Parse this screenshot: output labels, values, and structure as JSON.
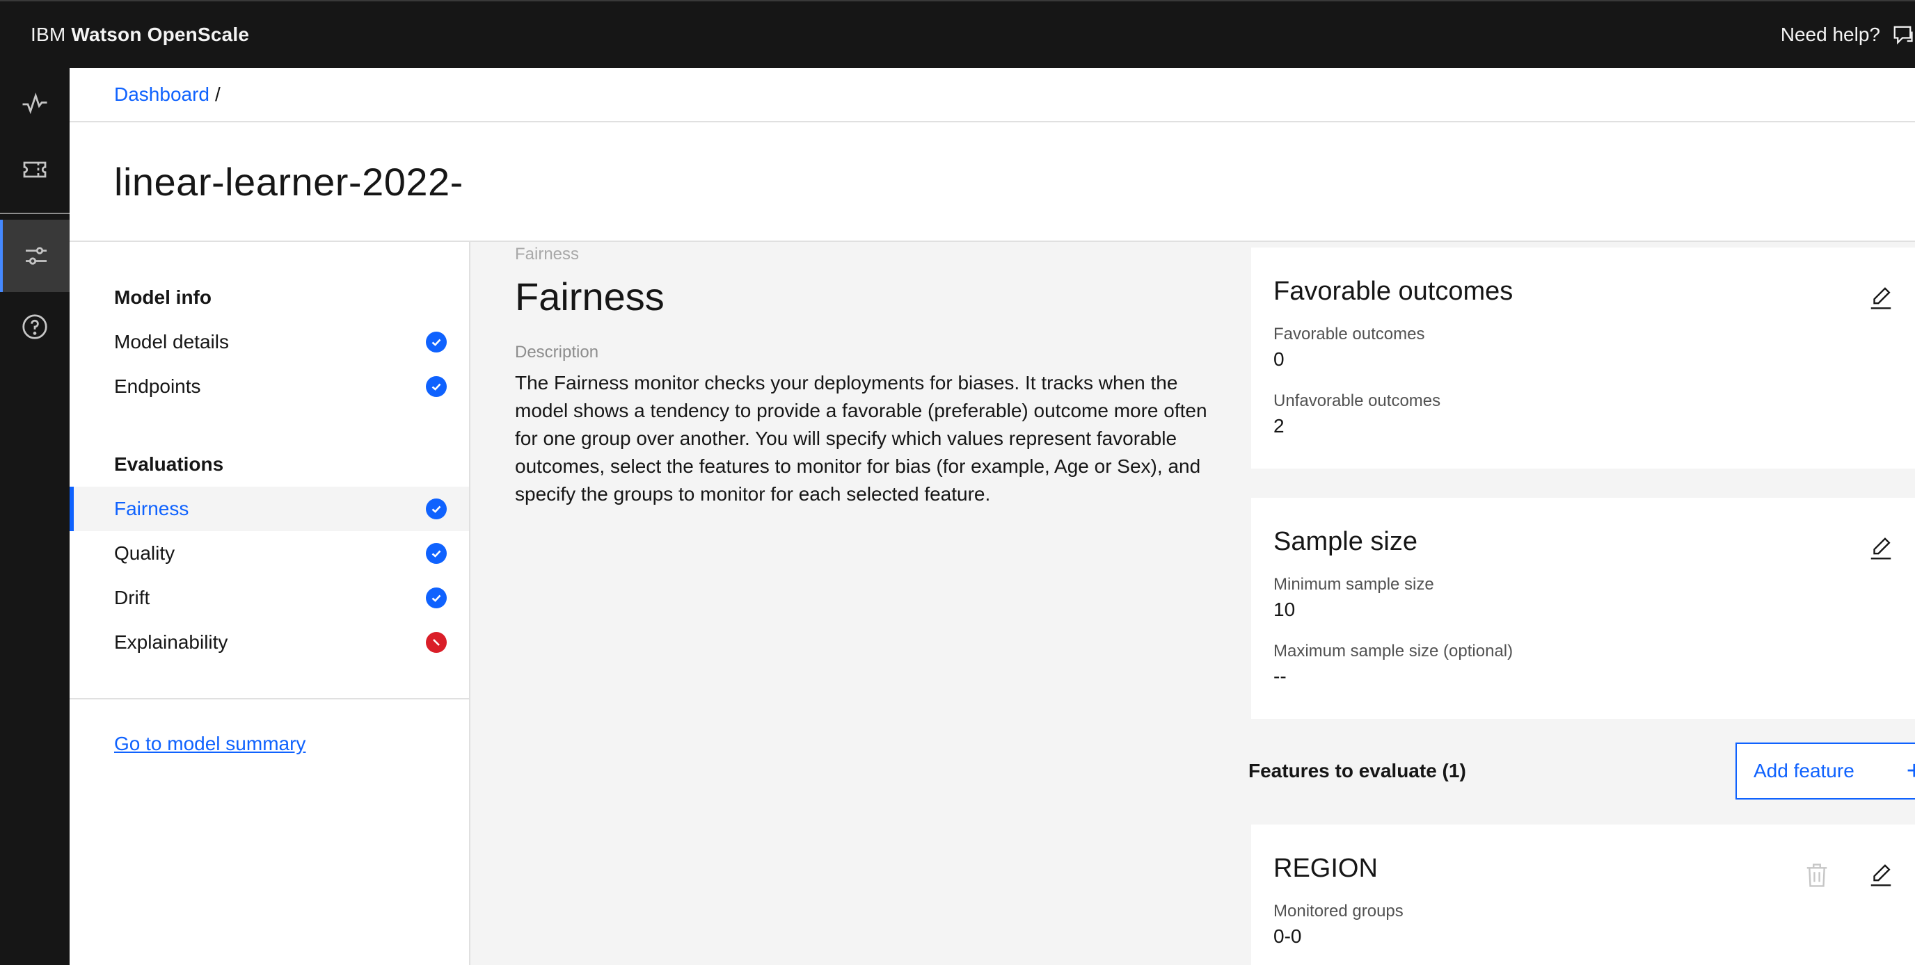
{
  "header": {
    "brand_prefix": "IBM",
    "brand_name": "Watson OpenScale",
    "help_label": "Need help?"
  },
  "rail": {
    "items": [
      {
        "icon": "activity-icon"
      },
      {
        "icon": "ticket-icon"
      },
      {
        "icon": "sliders-icon",
        "active": true
      },
      {
        "icon": "help-icon"
      }
    ]
  },
  "breadcrumb": {
    "dashboard": "Dashboard",
    "separator": "/"
  },
  "page": {
    "title": "linear-learner-2022-"
  },
  "leftnav": {
    "model_info_heading": "Model info",
    "model_details": "Model details",
    "endpoints": "Endpoints",
    "evaluations_heading": "Evaluations",
    "fairness": "Fairness",
    "quality": "Quality",
    "drift": "Drift",
    "explainability": "Explainability",
    "summary_link": "Go to model summary"
  },
  "content": {
    "eyebrow": "Fairness",
    "title": "Fairness",
    "description_label": "Description",
    "description": "The Fairness monitor checks your deployments for biases. It tracks when the model shows a tendency to provide a favorable (preferable) outcome more often for one group over another. You will specify which values represent favorable outcomes, select the features to monitor for bias (for example, Age or Sex), and specify the groups to monitor for each selected feature."
  },
  "favorable_card": {
    "title": "Favorable outcomes",
    "favorable_label": "Favorable outcomes",
    "favorable_value": "0",
    "unfavorable_label": "Unfavorable outcomes",
    "unfavorable_value": "2"
  },
  "sample_card": {
    "title": "Sample size",
    "min_label": "Minimum sample size",
    "min_value": "10",
    "max_label": "Maximum sample size (optional)",
    "max_value": "--"
  },
  "features": {
    "label": "Features to evaluate (1)",
    "add_button": "Add feature",
    "add_icon": "+"
  },
  "region_card": {
    "title": "REGION",
    "groups_label": "Monitored groups",
    "groups_value": "0-0"
  },
  "colors": {
    "accent": "#0f62fe",
    "error": "#da1e28",
    "header_bg": "#161616"
  }
}
